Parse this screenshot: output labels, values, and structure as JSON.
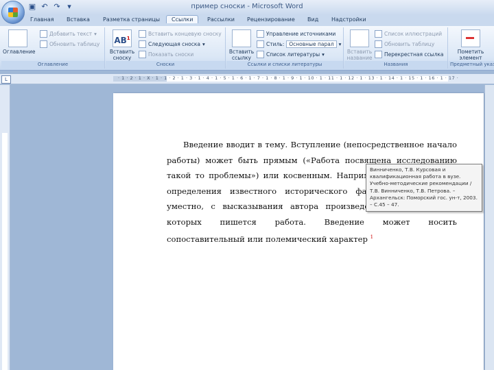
{
  "window": {
    "title": "пример сноски - Microsoft Word"
  },
  "quick_access": {
    "icons": [
      "save-icon",
      "undo-icon",
      "redo-icon",
      "customize-icon"
    ]
  },
  "tabs": [
    {
      "label": "Главная"
    },
    {
      "label": "Вставка"
    },
    {
      "label": "Разметка страницы"
    },
    {
      "label": "Ссылки"
    },
    {
      "label": "Рассылки"
    },
    {
      "label": "Рецензирование"
    },
    {
      "label": "Вид"
    },
    {
      "label": "Надстройки"
    }
  ],
  "active_tab": "Ссылки",
  "ribbon": {
    "toc_group": {
      "label": "Оглавление",
      "toc_button": "Оглавление",
      "add_text": "Добавить текст",
      "update_table": "Обновить таблицу"
    },
    "footnotes_group": {
      "label": "Сноски",
      "insert_footnote": "Вставить сноску",
      "insert_endnote": "Вставить концевую сноску",
      "next_footnote": "Следующая сноска",
      "show_notes": "Показать сноски"
    },
    "citations_group": {
      "label": "Ссылки и списки литературы",
      "insert_citation": "Вставить ссылку",
      "manage_sources": "Управление источниками",
      "style_label": "Стиль:",
      "style_value": "Основные парал",
      "bibliography": "Список литературы"
    },
    "captions_group": {
      "label": "Названия",
      "insert_caption": "Вставить название",
      "insert_table_of_figures": "Список иллюстраций",
      "update_table": "Обновить таблицу",
      "cross_reference": "Перекрестная ссылка"
    },
    "index_group": {
      "label": "Предметный указатель",
      "mark_entry": "Пометить элемент"
    }
  },
  "ruler": {
    "corner_symbol": "L",
    "marks": "· 1 · 2 · 1 · X · 1 · 1 · 2 · 1 · 3 · 1 · 4 · 1 · 5 · 1 · 6 · 1 · 7 · 1 · 8 · 1 · 9 · 1 · 10 · 1 · 11 · 1 · 12 · 1 · 13 · 1 · 14 · 1 · 15 · 1 · 16 · 1 · 17 ·"
  },
  "document": {
    "paragraph": "Введение вводит в тему. Вступление (непосредственное начало работы) может быть прямым («Работа посвящена исследованию такой то проблемы») или косвенным. Например, можно начать с определения известного исторического факта или, если это уместно, с высказывания автора произведений, на материале которых пишется работа. Введение может носить сопоставительный или полемический характер",
    "footnote_ref": "1"
  },
  "footnote_tooltip": {
    "text": "Винниченко, Т.В. Курсовая и квалификационная работа в вузе. Учебно-методические рекомендации / Т.В. Винниченко, Т.В. Петрова. – Архангельск: Поморский гос. ун-т, 2003. – С.45 – 47."
  },
  "colors": {
    "ribbon_top": "#f4f8fd",
    "ribbon_bottom": "#c6d8ef",
    "workspace": "#9fb7d6",
    "footnote_ref": "#cc0000"
  }
}
